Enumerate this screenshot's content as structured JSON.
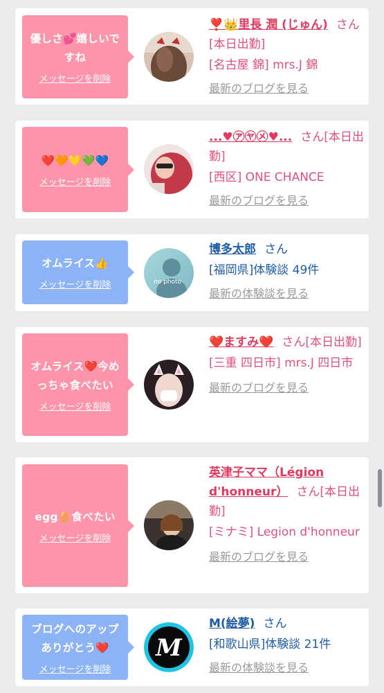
{
  "cards": [
    {
      "bubble_text": "優しさ💕嬉しいですね",
      "delete_label": "メッセージを削除",
      "name": "❣️👑里長 潤 (じゅん)",
      "honorific": "さん",
      "status": "[本日出勤]",
      "location": "[名古屋 錦] mrs.J 錦",
      "link": "最新のブログを見る"
    },
    {
      "bubble_text": "❤️🧡💛💚💙",
      "delete_label": "メッセージを削除",
      "name": "...♥㋐㋳㋱♥...",
      "honorific": "さん",
      "status": "[本日出勤]",
      "location": "[西区] ONE CHANCE",
      "link": "最新のブログを見る"
    },
    {
      "bubble_text": "オムライス👍",
      "delete_label": "メッセージを削除",
      "name": "博多太郎",
      "honorific": "さん",
      "status": "",
      "location": "[福岡県]体験談 49件",
      "link": "最新の体験談を見る",
      "avatar_text": "no photo"
    },
    {
      "bubble_text": "オムライス❤️今めっちゃ食べたい",
      "delete_label": "メッセージを削除",
      "name": "❤️ますみ❤️",
      "honorific": "さん",
      "status": "[本日出勤]",
      "location": "[三重 四日市] mrs.J 四日市",
      "link": "最新のブログを見る"
    },
    {
      "bubble_text": "egg🥚食べたい",
      "delete_label": "メッセージを削除",
      "name": "英津子ママ（Légion d'honneur）",
      "honorific": "さん",
      "status": "[本日出勤]",
      "location": "[ミナミ] Legion d'honneur",
      "link": "最新のブログを見る"
    },
    {
      "bubble_text": "ブログへのアップありがとう❤️",
      "delete_label": "メッセージを削除",
      "name": "M(絵夢)",
      "honorific": "さん",
      "status": "",
      "location": "[和歌山県]体験談 21件",
      "link": "最新の体験談を見る"
    }
  ],
  "colors": {
    "pink_bubble": "#fd94a9",
    "blue_bubble": "#8cb3f6",
    "pink_text": "#e24f7a",
    "blue_text": "#1f5da6",
    "link_gray": "#9a9a9a"
  }
}
